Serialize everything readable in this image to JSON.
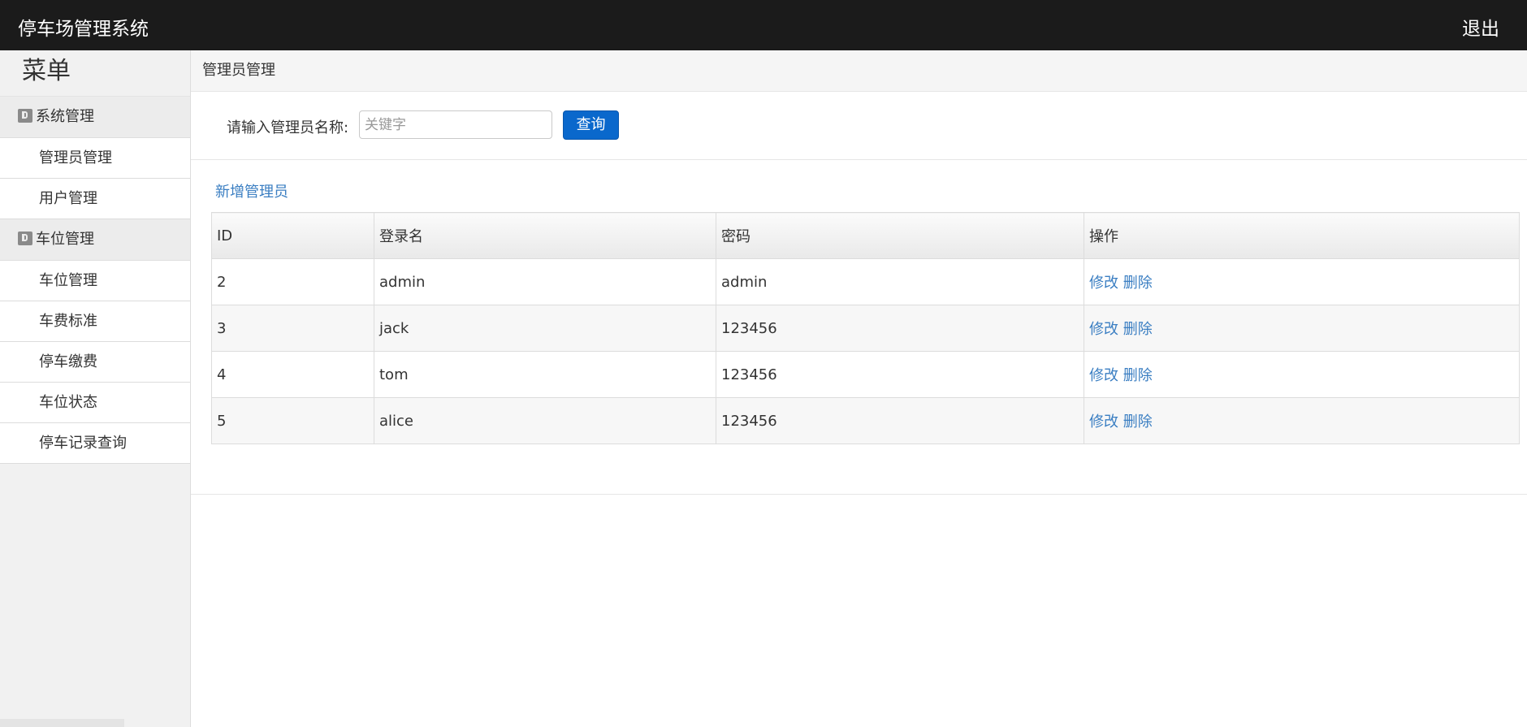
{
  "header": {
    "title": "停车场管理系统",
    "logout": "退出"
  },
  "sidebar": {
    "menu_title": "菜单",
    "groups": [
      {
        "label": "系统管理",
        "items": [
          "管理员管理",
          "用户管理"
        ]
      },
      {
        "label": "车位管理",
        "items": [
          "车位管理",
          "车费标准",
          "停车缴费",
          "车位状态",
          "停车记录查询"
        ]
      }
    ]
  },
  "main": {
    "breadcrumb": "管理员管理",
    "search": {
      "label": "请输入管理员名称:",
      "placeholder": "关键字",
      "value": "",
      "button": "查询"
    },
    "add_link": "新增管理员",
    "table": {
      "headers": [
        "ID",
        "登录名",
        "密码",
        "操作"
      ],
      "rows": [
        {
          "id": "2",
          "login": "admin",
          "password": "admin",
          "edit": "修改",
          "delete": "删除"
        },
        {
          "id": "3",
          "login": "jack",
          "password": "123456",
          "edit": "修改",
          "delete": "删除"
        },
        {
          "id": "4",
          "login": "tom",
          "password": "123456",
          "edit": "修改",
          "delete": "删除"
        },
        {
          "id": "5",
          "login": "alice",
          "password": "123456",
          "edit": "修改",
          "delete": "删除"
        }
      ]
    }
  },
  "colors": {
    "topbar": "#1b1b1b",
    "primary_button": "#0a68cc",
    "link": "#3a7ec2"
  }
}
